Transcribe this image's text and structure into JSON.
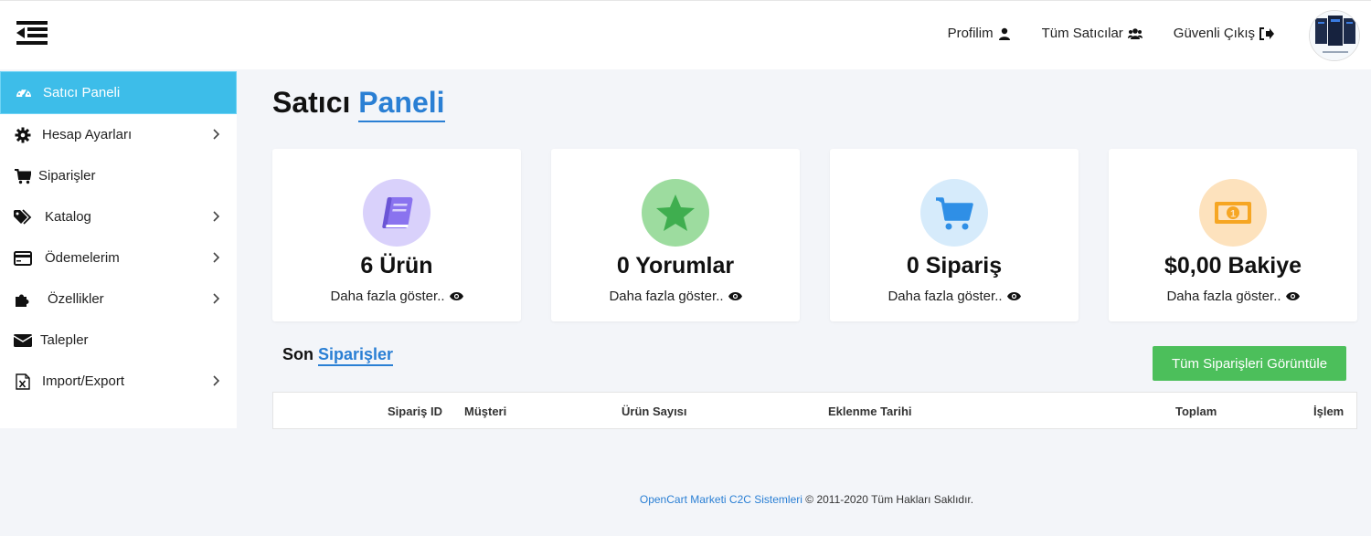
{
  "header": {
    "nav": [
      {
        "label": "Profilim",
        "icon": "user-icon"
      },
      {
        "label": "Tüm Satıcılar",
        "icon": "users-icon"
      },
      {
        "label": "Güvenli Çıkış",
        "icon": "sign-out-icon"
      }
    ]
  },
  "sidebar": {
    "items": [
      {
        "label": "Satıcı Paneli",
        "icon": "dashboard-icon",
        "active": true,
        "has_submenu": false
      },
      {
        "label": "Hesap Ayarları",
        "icon": "gear-icon",
        "has_submenu": true
      },
      {
        "label": "Siparişler",
        "icon": "cart-icon",
        "has_submenu": false
      },
      {
        "label": "Katalog",
        "icon": "tags-icon",
        "has_submenu": true
      },
      {
        "label": "Ödemelerim",
        "icon": "credit-card-icon",
        "has_submenu": true
      },
      {
        "label": "Özellikler",
        "icon": "puzzle-icon",
        "has_submenu": true
      },
      {
        "label": "Talepler",
        "icon": "envelope-icon",
        "has_submenu": false
      },
      {
        "label": "Import/Export",
        "icon": "excel-file-icon",
        "has_submenu": true
      }
    ]
  },
  "page": {
    "title_part1": "Satıcı",
    "title_part2": "Paneli"
  },
  "cards": [
    {
      "value": "6 Ürün",
      "more": "Daha fazla göster..",
      "icon": "book-icon",
      "color": "#8a73ef",
      "bg": "#d9d1fb"
    },
    {
      "value": "0 Yorumlar",
      "more": "Daha fazla göster..",
      "icon": "star-icon",
      "color": "#3fae4f",
      "bg": "#9ddc9f"
    },
    {
      "value": "0 Sipariş",
      "more": "Daha fazla göster..",
      "icon": "cart-icon",
      "color": "#2f8fe6",
      "bg": "#d6ebfb"
    },
    {
      "value": "$0,00 Bakiye",
      "more": "Daha fazla göster..",
      "icon": "money-icon",
      "color": "#f6a623",
      "bg": "#fde2bd"
    }
  ],
  "orders": {
    "title_part1": "Son",
    "title_part2": "Siparişler",
    "view_all_label": "Tüm Siparişleri Görüntüle",
    "columns": [
      "Sipariş ID",
      "Müşteri",
      "Ürün Sayısı",
      "Eklenme Tarihi",
      "Toplam",
      "İşlem"
    ],
    "rows": []
  },
  "footer": {
    "link": "OpenCart Marketi C2C Sistemleri",
    "text": "© 2011-2020 Tüm Hakları Saklıdır."
  },
  "colors": {
    "accent": "#2a7fd4",
    "sidebar_active": "#3dbde9",
    "button_green": "#4cbf5b"
  }
}
